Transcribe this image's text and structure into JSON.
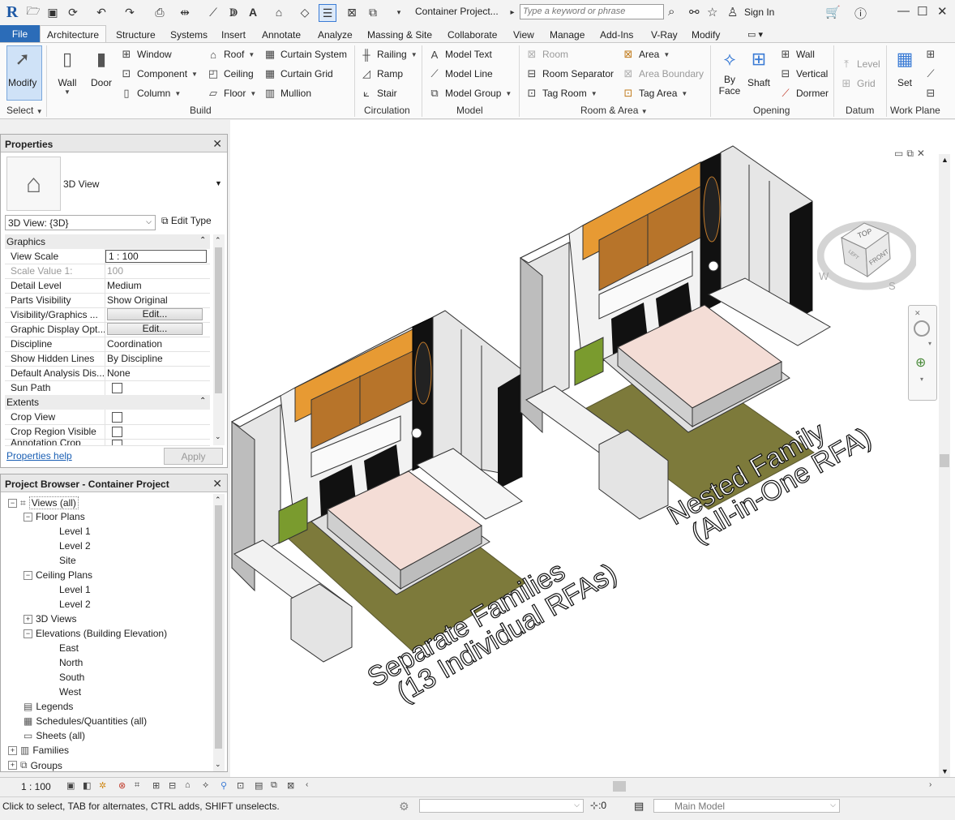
{
  "titlebar": {
    "app_logo": "R",
    "doc_title": "Container Project...",
    "search_placeholder": "Type a keyword or phrase",
    "sign_in": "Sign In"
  },
  "tabs": [
    "File",
    "Architecture",
    "Structure",
    "Systems",
    "Insert",
    "Annotate",
    "Analyze",
    "Massing & Site",
    "Collaborate",
    "View",
    "Manage",
    "Add-Ins",
    "V-Ray",
    "Modify"
  ],
  "ribbon": {
    "select": {
      "modify": "Modify",
      "panel": "Select"
    },
    "build": {
      "wall": "Wall",
      "door": "Door",
      "window": "Window",
      "component": "Component",
      "column": "Column",
      "roof": "Roof",
      "ceiling": "Ceiling",
      "floor": "Floor",
      "curtain_system": "Curtain System",
      "curtain_grid": "Curtain  Grid",
      "mullion": "Mullion",
      "panel": "Build"
    },
    "circulation": {
      "railing": "Railing",
      "ramp": "Ramp",
      "stair": "Stair",
      "panel": "Circulation"
    },
    "model": {
      "model_text": "Model  Text",
      "model_line": "Model  Line",
      "model_group": "Model  Group",
      "panel": "Model"
    },
    "room_area": {
      "room": "Room",
      "room_separator": "Room  Separator",
      "tag_room": "Tag  Room",
      "area": "Area",
      "area_boundary": "Area  Boundary",
      "tag_area": "Tag  Area",
      "panel": "Room & Area"
    },
    "opening": {
      "by_face": "By Face",
      "shaft": "Shaft",
      "wall": "Wall",
      "vertical": "Vertical",
      "dormer": "Dormer",
      "panel": "Opening"
    },
    "datum": {
      "level": "Level",
      "grid": "Grid",
      "panel": "Datum"
    },
    "work_plane": {
      "set": "Set",
      "panel": "Work Plane"
    }
  },
  "properties": {
    "title": "Properties",
    "type_name": "3D View",
    "view_selector": "3D View: {3D}",
    "edit_type": "Edit Type",
    "groups": [
      {
        "name": "Graphics",
        "rows": [
          {
            "key": "View Scale",
            "value": "1 : 100"
          },
          {
            "key": "Scale Value    1:",
            "value": "100"
          },
          {
            "key": "Detail Level",
            "value": "Medium"
          },
          {
            "key": "Parts Visibility",
            "value": "Show Original"
          },
          {
            "key": "Visibility/Graphics ...",
            "value": "Edit..."
          },
          {
            "key": "Graphic Display Opt...",
            "value": "Edit..."
          },
          {
            "key": "Discipline",
            "value": "Coordination"
          },
          {
            "key": "Show Hidden Lines",
            "value": "By Discipline"
          },
          {
            "key": "Default Analysis Dis...",
            "value": "None"
          },
          {
            "key": "Sun Path",
            "value": ""
          }
        ]
      },
      {
        "name": "Extents",
        "rows": [
          {
            "key": "Crop View",
            "value": ""
          },
          {
            "key": "Crop Region Visible",
            "value": ""
          },
          {
            "key": "Annotation Crop",
            "value": ""
          }
        ]
      }
    ],
    "help_link": "Properties help",
    "apply": "Apply"
  },
  "browser": {
    "title": "Project Browser - Container Project",
    "items": [
      {
        "label": "Views (all)"
      },
      {
        "label": "Floor Plans"
      },
      {
        "label": "Level 1"
      },
      {
        "label": "Level 2"
      },
      {
        "label": "Site"
      },
      {
        "label": "Ceiling Plans"
      },
      {
        "label": "Level 1"
      },
      {
        "label": "Level 2"
      },
      {
        "label": "3D Views"
      },
      {
        "label": "Elevations (Building Elevation)"
      },
      {
        "label": "East"
      },
      {
        "label": "North"
      },
      {
        "label": "South"
      },
      {
        "label": "West"
      },
      {
        "label": "Legends"
      },
      {
        "label": "Schedules/Quantities (all)"
      },
      {
        "label": "Sheets (all)"
      },
      {
        "label": "Families"
      },
      {
        "label": "Groups"
      }
    ]
  },
  "viewport": {
    "label_left_line1": "Separate Families",
    "label_left_line2": "(13 Individual RFAs)",
    "label_right_line1": "Nested Family",
    "label_right_line2": "(All-in-One RFA)",
    "viewcube_top": "TOP",
    "viewcube_front": "FRONT",
    "viewcube_left": "LEFT",
    "compass_w": "W",
    "compass_s": "S"
  },
  "view_control": {
    "scale": "1 : 100"
  },
  "status": {
    "message": "Click to select, TAB for alternates, CTRL adds, SHIFT unselects.",
    "count": ":0",
    "model": "Main Model"
  },
  "colors": {
    "file_tab": "#2b6cb8",
    "wood": "#b7742a",
    "cabinet_top": "#e79a33",
    "rug": "#7d7a3b",
    "bed": "#f4ddd6",
    "accent_green": "#a3c24a"
  }
}
